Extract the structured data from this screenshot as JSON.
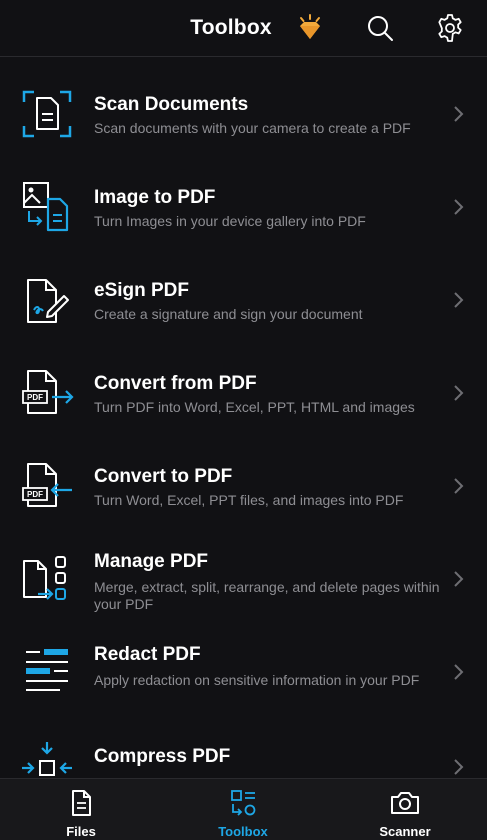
{
  "header": {
    "title": "Toolbox",
    "icons": [
      "premium-diamond-icon",
      "search-icon",
      "gear-icon"
    ]
  },
  "colors": {
    "accent": "#1ea7e6",
    "premium": "#f2a93b",
    "background": "#111114",
    "secondary_text": "#8e8e93"
  },
  "tools": [
    {
      "title": "Scan Documents",
      "description": "Scan documents with your camera to create a PDF",
      "icon": "scan-document-icon"
    },
    {
      "title": "Image to PDF",
      "description": "Turn Images in your device gallery into PDF",
      "icon": "image-to-pdf-icon"
    },
    {
      "title": "eSign PDF",
      "description": "Create a signature and sign your document",
      "icon": "esign-icon"
    },
    {
      "title": "Convert from PDF",
      "description": "Turn PDF into Word, Excel, PPT, HTML and images",
      "icon": "convert-from-pdf-icon"
    },
    {
      "title": "Convert to PDF",
      "description": "Turn Word, Excel, PPT files, and images into PDF",
      "icon": "convert-to-pdf-icon"
    },
    {
      "title": "Manage PDF",
      "description": "Merge, extract, split, rearrange, and delete pages within your PDF",
      "icon": "manage-pdf-icon"
    },
    {
      "title": "Redact PDF",
      "description": "Apply redaction on sensitive information in your PDF",
      "icon": "redact-icon"
    },
    {
      "title": "Compress PDF",
      "description": "",
      "icon": "compress-icon"
    }
  ],
  "tabs": [
    {
      "label": "Files",
      "icon": "files-icon",
      "active": false
    },
    {
      "label": "Toolbox",
      "icon": "toolbox-icon",
      "active": true
    },
    {
      "label": "Scanner",
      "icon": "camera-icon",
      "active": false
    }
  ]
}
